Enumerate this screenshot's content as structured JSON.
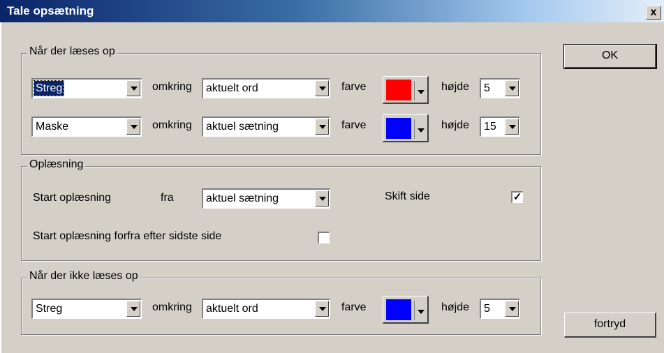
{
  "window": {
    "title": "Tale opsætning",
    "close_label": "x"
  },
  "section_reading": {
    "legend": "Når der læses op",
    "row1": {
      "shape": "Streg",
      "around_label": "omkring",
      "target": "aktuelt ord",
      "color_label": "farve",
      "color": "#ff0000",
      "height_label": "højde",
      "height": "5"
    },
    "row2": {
      "shape": "Maske",
      "around_label": "omkring",
      "target": "aktuel sætning",
      "color_label": "farve",
      "color": "#0000ff",
      "height_label": "højde",
      "height": "15"
    }
  },
  "section_oplaesning": {
    "legend": "Oplæsning",
    "start_label": "Start oplæsning",
    "from_label": "fra",
    "from_value": "aktuel sætning",
    "skift_side_label": "Skift side",
    "skift_side_checked": true,
    "restart_label": "Start oplæsning forfra efter sidste side",
    "restart_checked": false
  },
  "section_not_reading": {
    "legend": "Når der ikke læses op",
    "row1": {
      "shape": "Streg",
      "around_label": "omkring",
      "target": "aktuelt ord",
      "color_label": "farve",
      "color": "#0000ff",
      "height_label": "højde",
      "height": "5"
    }
  },
  "buttons": {
    "ok": "OK",
    "cancel": "fortryd"
  },
  "checkmark": "✓"
}
